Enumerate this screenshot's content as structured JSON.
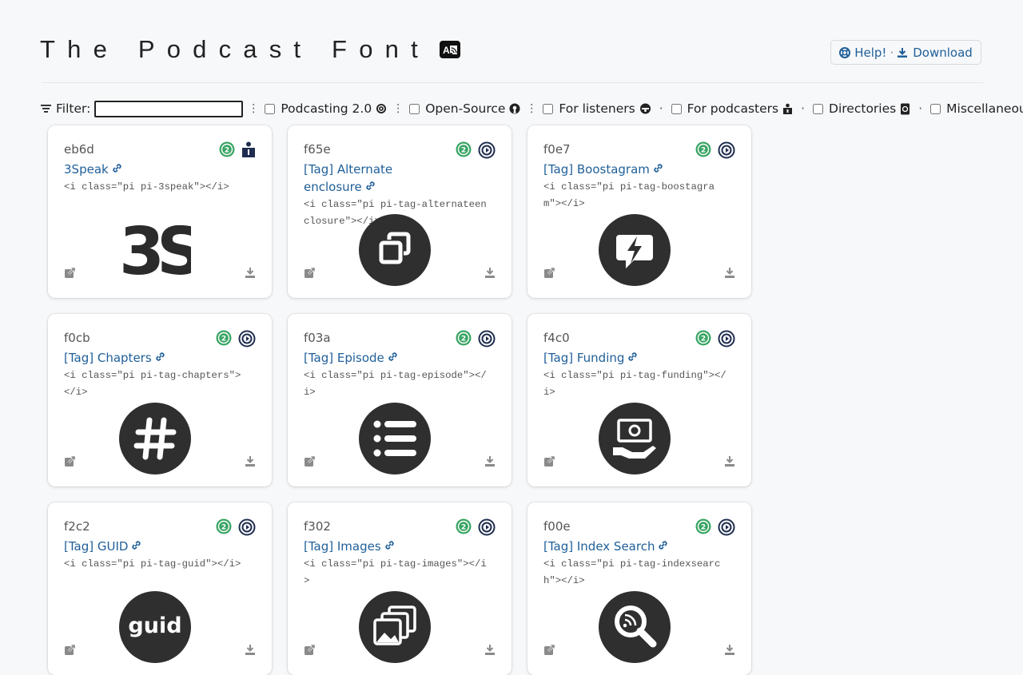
{
  "header": {
    "title": "The Podcast Font"
  },
  "top_links": {
    "help": "Help!",
    "separator": "·",
    "download": "Download"
  },
  "filters": {
    "label": "Filter:",
    "input_value": "",
    "dots": "⋮",
    "dot": "·",
    "categories": [
      "Podcasting 2.0",
      "Open-Source",
      "For listeners",
      "For podcasters",
      "Directories",
      "Miscellaneous"
    ]
  },
  "cards": [
    {
      "code": "eb6d",
      "title": "3Speak",
      "snippet": "<i class=\"pi pi-3speak\"></i>",
      "icon": "3speak-logo",
      "badge2": "podcaster-icon"
    },
    {
      "code": "f65e",
      "title": "[Tag] Alternate enclosure",
      "snippet": "<i class=\"pi pi-tag-alternateenclosure\"></i>",
      "icon": "alternate-enclosure-icon",
      "badge2": "tag-target-icon"
    },
    {
      "code": "f0e7",
      "title": "[Tag] Boostagram",
      "snippet": "<i class=\"pi pi-tag-boostagram\"></i>",
      "icon": "boostagram-icon",
      "badge2": "tag-target-icon"
    },
    {
      "code": "f0cb",
      "title": "[Tag] Chapters",
      "snippet": "<i class=\"pi pi-tag-chapters\"></i>",
      "icon": "chapters-icon",
      "badge2": "tag-target-icon"
    },
    {
      "code": "f03a",
      "title": "[Tag] Episode",
      "snippet": "<i class=\"pi pi-tag-episode\"></i>",
      "icon": "episode-icon",
      "badge2": "tag-target-icon"
    },
    {
      "code": "f4c0",
      "title": "[Tag] Funding",
      "snippet": "<i class=\"pi pi-tag-funding\"></i>",
      "icon": "funding-icon",
      "badge2": "tag-target-icon"
    },
    {
      "code": "f2c2",
      "title": "[Tag] GUID",
      "snippet": "<i class=\"pi pi-tag-guid\"></i>",
      "icon": "guid-icon",
      "badge2": "tag-target-icon",
      "icon_text": "guid"
    },
    {
      "code": "f302",
      "title": "[Tag] Images",
      "snippet": "<i class=\"pi pi-tag-images\"></i>",
      "icon": "images-icon",
      "badge2": "tag-target-icon"
    },
    {
      "code": "f00e",
      "title": "[Tag] Index Search",
      "snippet": "<i class=\"pi pi-tag-indexsearch\"></i>",
      "icon": "index-search-icon",
      "badge2": "tag-target-icon"
    }
  ],
  "colors": {
    "link": "#1f5f99",
    "badge_green": "#3aa564",
    "icon_dark": "#333333",
    "navy": "#1e2c4f"
  }
}
